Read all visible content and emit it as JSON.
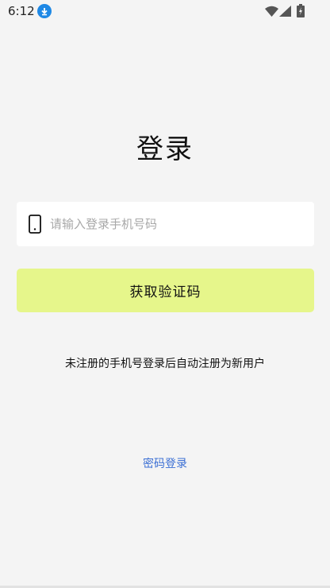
{
  "status_bar": {
    "time": "6:12",
    "icons": [
      "download-icon",
      "wifi-icon",
      "signal-icon",
      "battery-icon"
    ]
  },
  "login": {
    "title": "登录",
    "phone_placeholder": "请输入登录手机号码",
    "phone_value": "",
    "get_code_label": "获取验证码",
    "hint": "未注册的手机号登录后自动注册为新用户",
    "password_login_label": "密码登录"
  },
  "colors": {
    "background": "#f4f4f4",
    "button": "#e6f68b",
    "link": "#3b6fd4",
    "download_badge": "#1e88e5"
  }
}
